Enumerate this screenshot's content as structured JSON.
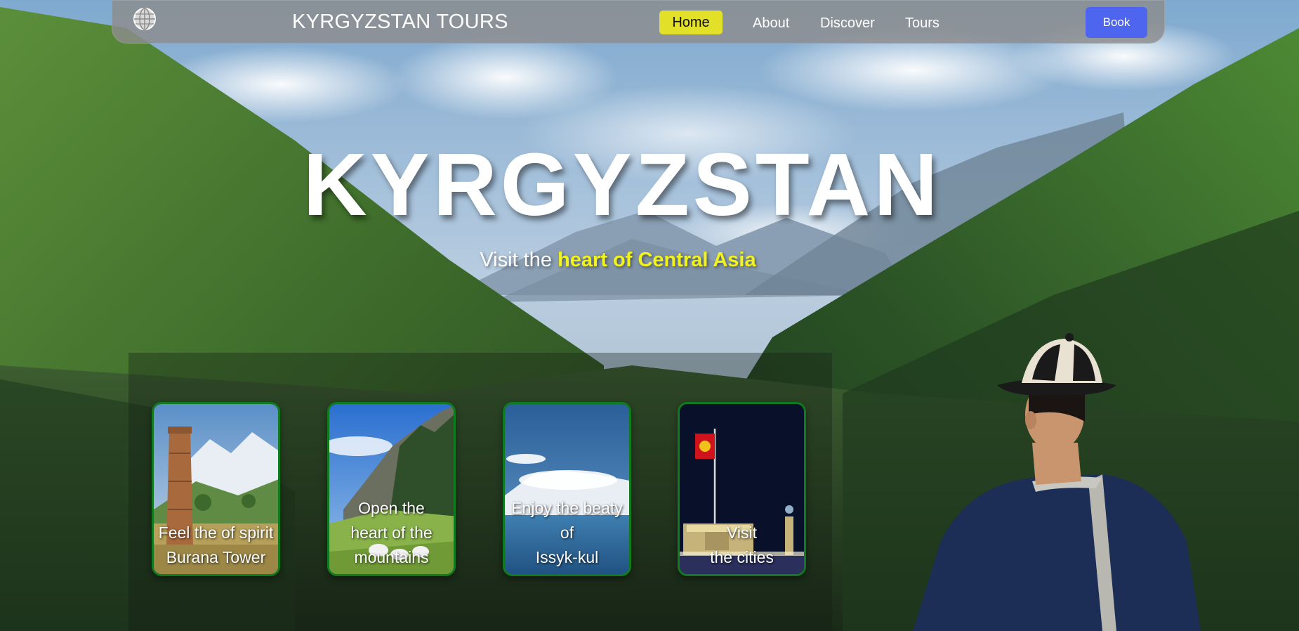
{
  "nav": {
    "brand": "KYRGYZSTAN TOURS",
    "links": [
      "Home",
      "About",
      "Discover",
      "Tours"
    ],
    "active": "Home",
    "book_label": "Book",
    "logo_icon": "globe-icon"
  },
  "hero": {
    "title": "KYRGYZSTAN",
    "tagline_prefix": "Visit the ",
    "tagline_highlight": "heart of Central Asia"
  },
  "cards": [
    {
      "caption": "Feel the of spirit\nBurana Tower",
      "image": "burana-tower"
    },
    {
      "caption": "Open the\nheart of the\nmountains",
      "image": "mountain-yurts"
    },
    {
      "caption": "Enjoy the beaty\nof\nIssyk-kul",
      "image": "issyk-kul-lake"
    },
    {
      "caption": "Visit\nthe cities",
      "image": "city-flag-night"
    }
  ],
  "colors": {
    "accent_home": "#e3e02a",
    "book_button": "#4d65ef",
    "highlight_text": "#f2f21c",
    "card_border": "#0f7a1e"
  }
}
